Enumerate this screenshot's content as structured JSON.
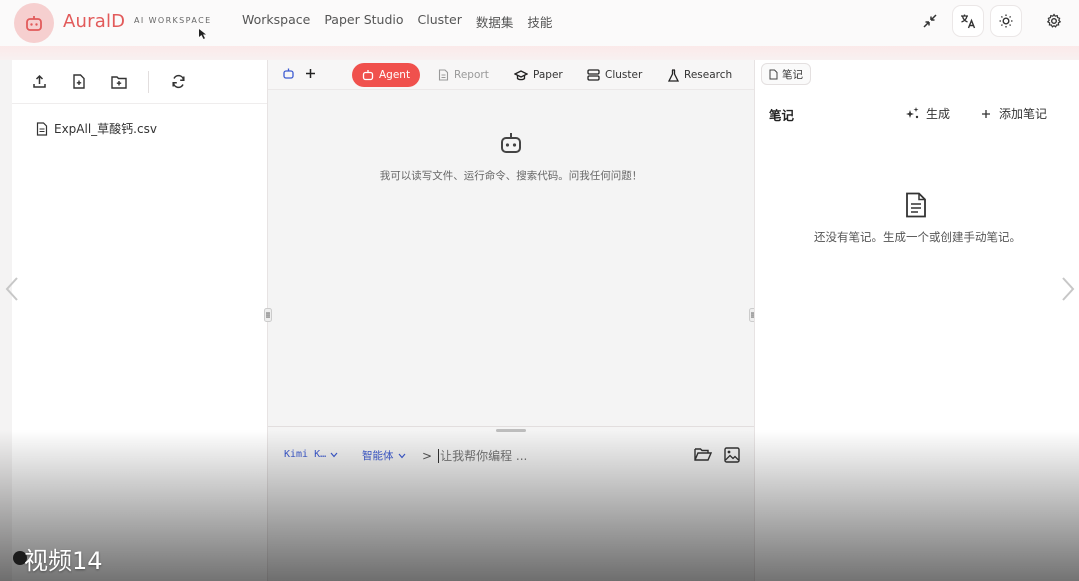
{
  "app": {
    "brand": "AuralD",
    "brand_sub": "AI WORKSPACE",
    "accent": "#e25a5a",
    "icons": [
      "robot-icon",
      "minimize-icon",
      "translate-icon",
      "sun-icon",
      "gear-icon"
    ]
  },
  "nav": {
    "items": [
      "Workspace",
      "Paper Studio",
      "Cluster",
      "数据集",
      "技能"
    ]
  },
  "left": {
    "file_name": "ExpAll_草酸钙.csv"
  },
  "middle": {
    "tabs": [
      {
        "label": "Agent",
        "active": true
      },
      {
        "label": "Report",
        "active": false
      },
      {
        "label": "Paper",
        "active": false
      },
      {
        "label": "Cluster",
        "active": false
      },
      {
        "label": "Research",
        "active": false
      }
    ],
    "empty_message": "我可以读写文件、运行命令、搜索代码。问我任何问题！",
    "composer": {
      "model": "Kimi K…",
      "mode": "智能体",
      "prompt_symbol": ">",
      "placeholder": "让我帮你编程 ..."
    }
  },
  "right": {
    "tab_label": "笔记",
    "title": "笔记",
    "generate_label": "生成",
    "add_label": "添加笔记",
    "empty_message": "还没有笔记。生成一个或创建手动笔记。"
  },
  "overlay": {
    "video_label": "视频14"
  }
}
